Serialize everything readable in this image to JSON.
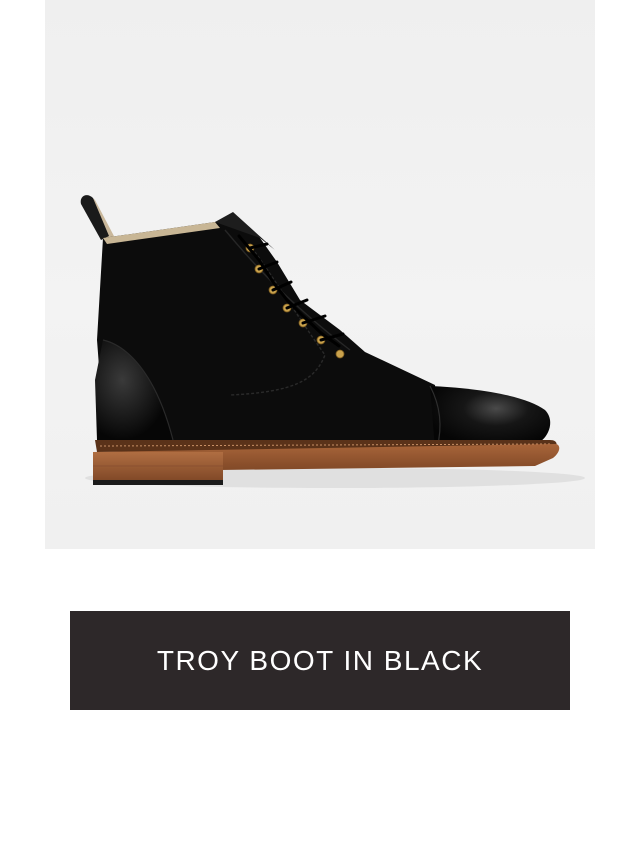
{
  "product": {
    "image_alt": "Black suede lace-up boot with leather cap toe and heel counter",
    "cta_label": "TROY BOOT IN BLACK"
  },
  "colors": {
    "button_bg": "#2d2829",
    "button_text": "#ffffff",
    "photo_bg": "#efefef"
  }
}
